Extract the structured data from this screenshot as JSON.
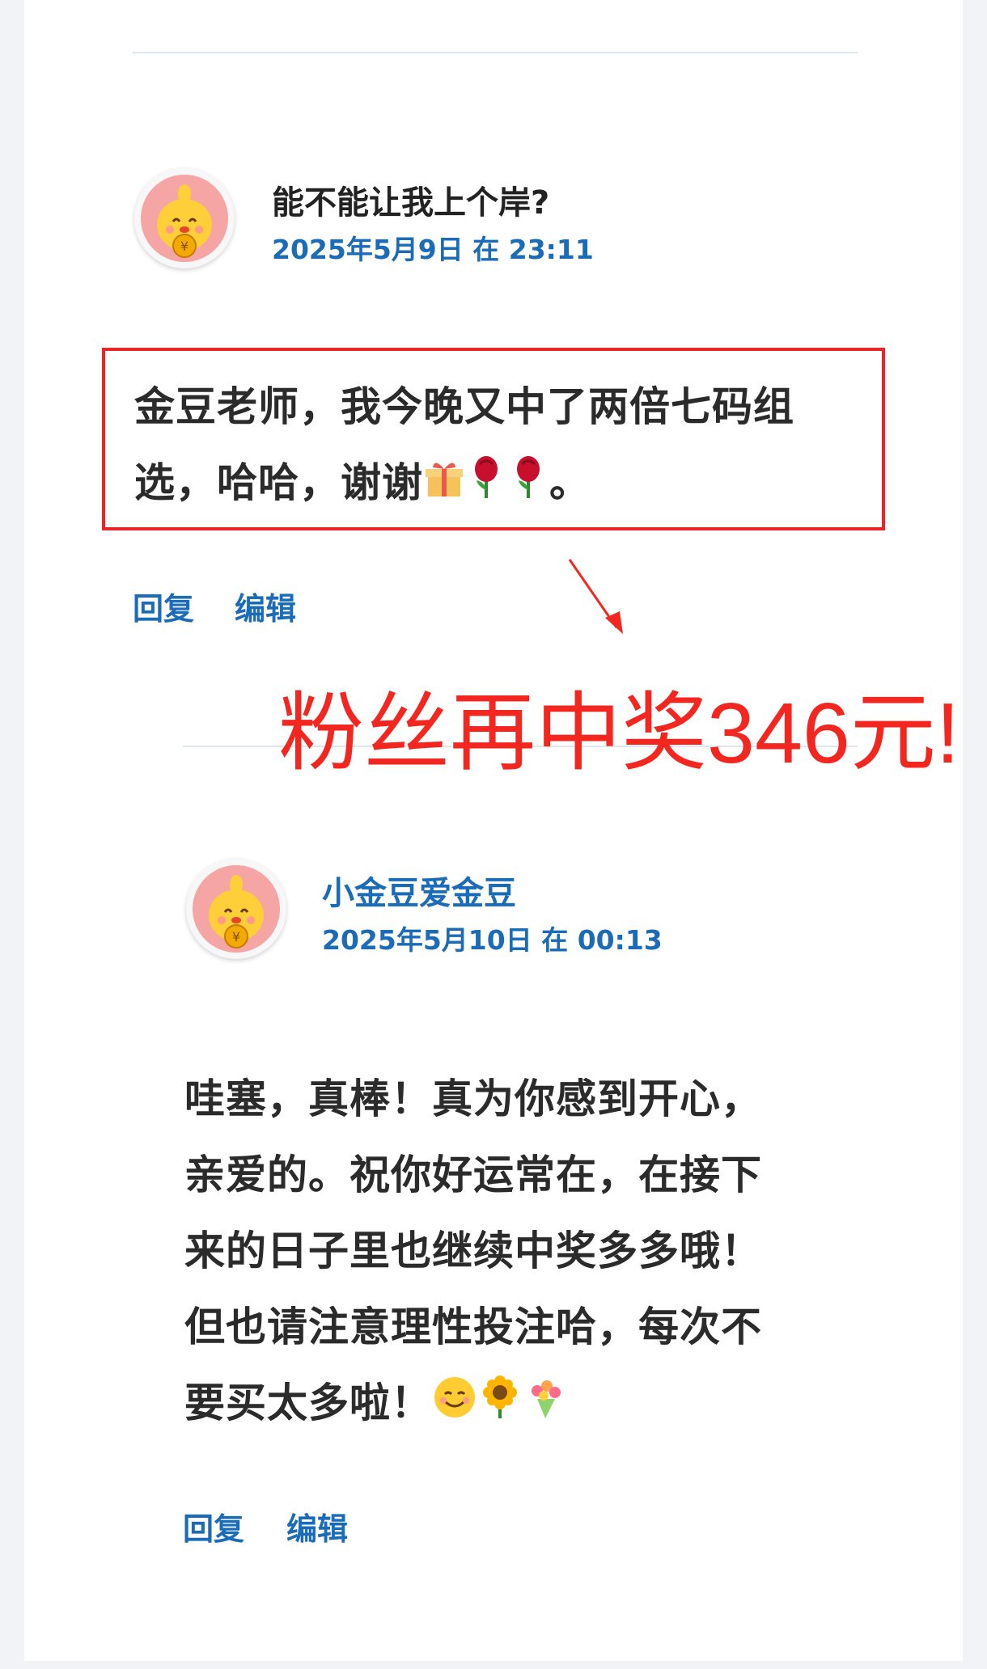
{
  "comments": [
    {
      "author": "能不能让我上个岸?",
      "date": "2025年5月9日 在 23:11",
      "text_lines": [
        "金豆老师，我今晚又中了两倍七码组",
        "选，哈哈，谢谢"
      ],
      "text_tail": "。",
      "reply_label": "回复",
      "edit_label": "编辑"
    },
    {
      "author": "小金豆爱金豆",
      "date": "2025年5月10日 在 00:13",
      "text_lines": [
        "哇塞，真棒！真为你感到开心，",
        "亲爱的。祝你好运常在，在接下",
        "来的日子里也继续中奖多多哦！",
        "但也请注意理性投注哈，每次不",
        "要买太多啦！"
      ],
      "reply_label": "回复",
      "edit_label": "编辑"
    }
  ],
  "annotation": {
    "text": "粉丝再中奖346元!",
    "color": "#f3271f"
  },
  "colors": {
    "link": "#1a6bb8",
    "highlight": "#e8262a"
  }
}
